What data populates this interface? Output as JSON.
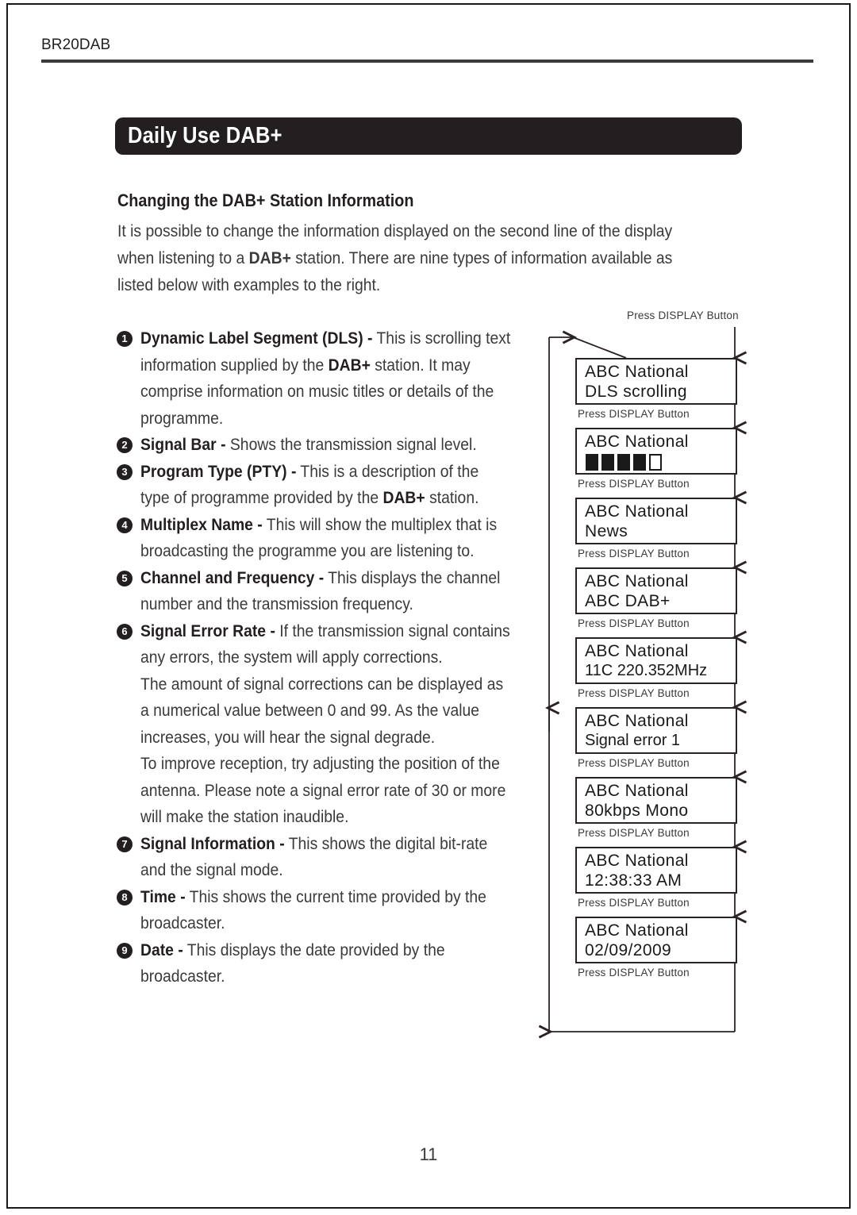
{
  "page": {
    "running_header": "BR20DAB",
    "page_number": "11"
  },
  "banner": {
    "title": "Daily Use DAB+"
  },
  "section": {
    "subheading": "Changing the DAB+ Station Information",
    "intro_lines": [
      "It is possible to change the information displayed on the second line of the display",
      "when listening to a DAB+ station. There are nine types of information available as",
      "listed below with examples to the right."
    ]
  },
  "list_items": [
    {
      "number": "1",
      "term": "Dynamic Label Segment (DLS)",
      "lines": [
        "<b>Dynamic Label Segment (DLS) -</b> This is scrolling text",
        "information supplied by the <b>DAB+</b> station. It may",
        "comprise information on music titles or details of the",
        "programme."
      ]
    },
    {
      "number": "2",
      "term": "Signal Bar",
      "lines": [
        "<b>Signal Bar -</b> Shows the transmission signal level."
      ]
    },
    {
      "number": "3",
      "term": "Program Type (PTY)",
      "lines": [
        "<b>Program Type (PTY) -</b> This is a description of the",
        "type of programme provided by the <b>DAB+</b> station."
      ]
    },
    {
      "number": "4",
      "term": "Multiplex Name",
      "lines": [
        "<b>Multiplex Name -</b> This will show the multiplex that is",
        "broadcasting the programme you are listening to."
      ]
    },
    {
      "number": "5",
      "term": "Channel and Frequency",
      "lines": [
        "<b>Channel and Frequency -</b> This displays the channel",
        "number and the transmission frequency."
      ]
    },
    {
      "number": "6",
      "term": "Signal Error Rate",
      "lines": [
        "<b>Signal Error Rate -</b> If the transmission signal contains",
        "any errors, the system will apply corrections.",
        "The amount of signal corrections can be displayed as",
        "a numerical value between 0 and 99. As the value",
        "increases, you will hear the signal degrade.",
        "To improve reception, try adjusting the position of the",
        "antenna. Please note a signal error rate of 30 or more",
        "will make the station inaudible."
      ]
    },
    {
      "number": "7",
      "term": "Signal Information",
      "lines": [
        "<b>Signal Information -</b> This shows the digital bit-rate",
        "and the signal mode."
      ]
    },
    {
      "number": "8",
      "term": "Time",
      "lines": [
        "<b>Time -</b> This shows the current time provided by the",
        "broadcaster."
      ]
    },
    {
      "number": "9",
      "term": "Date",
      "lines": [
        "<b>Date -</b> This displays the date provided by the",
        "broadcaster."
      ]
    }
  ],
  "diagram": {
    "press_label": "Press DISPLAY  Button",
    "screens": [
      {
        "line1": "ABC National",
        "line2": "DLS scrolling",
        "type": "text"
      },
      {
        "line1": "ABC National",
        "line2": "",
        "type": "signal_bar",
        "bars_filled": 4,
        "bars_total": 5
      },
      {
        "line1": "ABC National",
        "line2": "News",
        "type": "text"
      },
      {
        "line1": "ABC National",
        "line2": "ABC DAB+",
        "type": "text"
      },
      {
        "line1": "ABC National",
        "line2": "11C 220.352MHz",
        "type": "text"
      },
      {
        "line1": "ABC National",
        "line2": "Signal error 1",
        "type": "text"
      },
      {
        "line1": "ABC National",
        "line2": "80kbps Mono",
        "type": "text"
      },
      {
        "line1": "ABC National",
        "line2": "12:38:33 AM",
        "type": "text"
      },
      {
        "line1": "ABC National",
        "line2": "02/09/2009",
        "type": "text"
      }
    ]
  },
  "colors": {
    "banner_bg": "#231f20",
    "text": "#3a3a3a",
    "heading": "#231f20",
    "rule": "#3a3a3a",
    "lcd_border": "#2a2226"
  }
}
